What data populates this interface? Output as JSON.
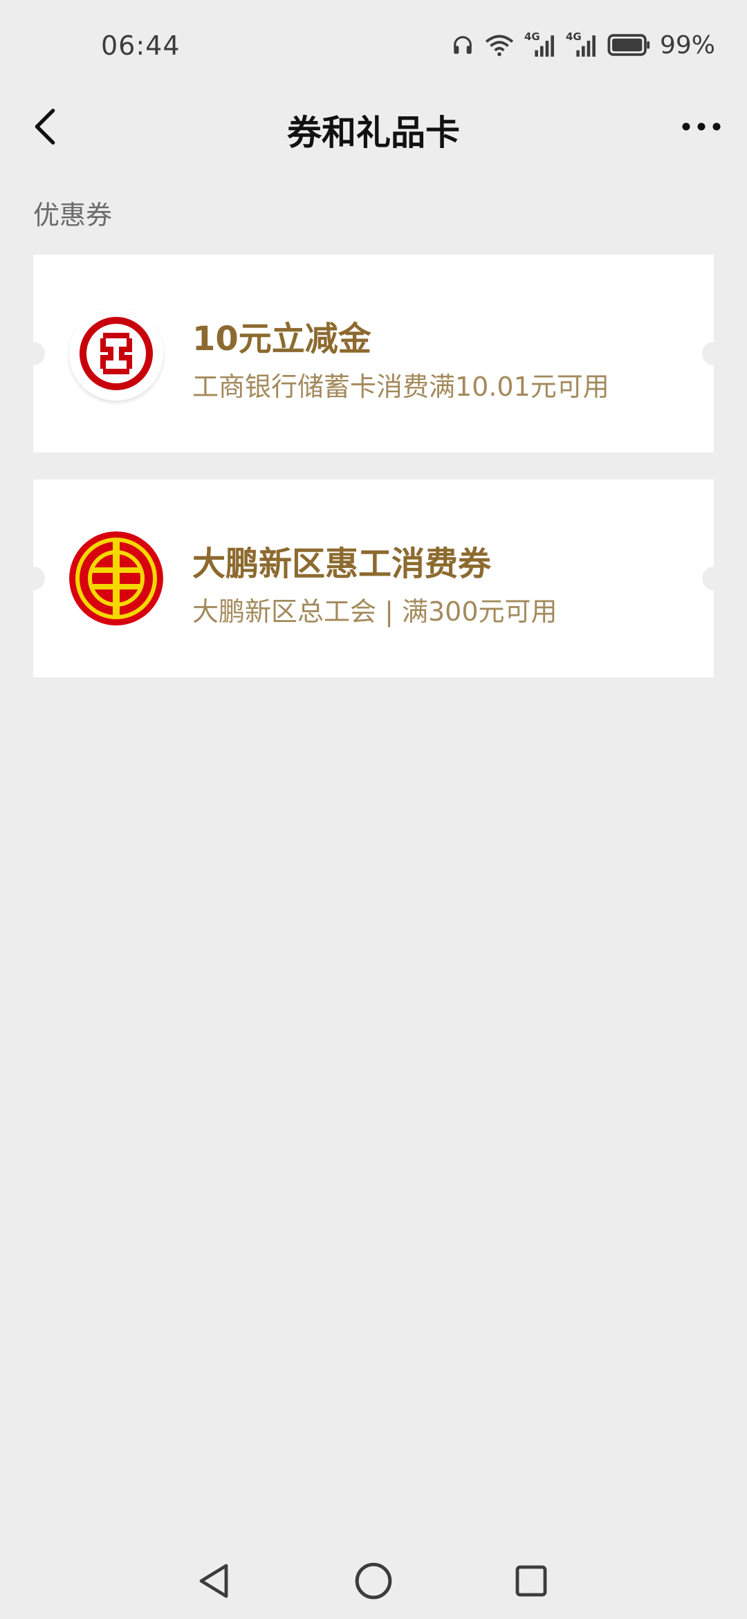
{
  "status_bar": {
    "time": "06:44",
    "battery": "99%",
    "network_a": "4G",
    "network_b": "4G"
  },
  "nav": {
    "title": "券和礼品卡"
  },
  "section": {
    "title": "优惠券"
  },
  "coupons": [
    {
      "name": "10元立减金",
      "description": "工商银行储蓄卡消费满10.01元可用"
    },
    {
      "name": "大鹏新区惠工消费券",
      "description": "大鹏新区总工会 | 满300元可用"
    }
  ],
  "colors": {
    "background": "#ededed",
    "card": "#ffffff",
    "coupon_title": "#8c6a2f",
    "coupon_desc": "#a38a5c",
    "icbc_red": "#c7000b",
    "union_red": "#d7000f",
    "union_yellow": "#f5d800"
  },
  "icons": {
    "back": "chevron-left-icon",
    "more": "more-dots-icon",
    "headphones": "headphones-icon",
    "wifi": "wifi-icon",
    "signal": "signal-icon",
    "battery": "battery-icon",
    "sys_back": "triangle-back-icon",
    "sys_home": "circle-home-icon",
    "sys_recent": "square-recent-icon"
  }
}
